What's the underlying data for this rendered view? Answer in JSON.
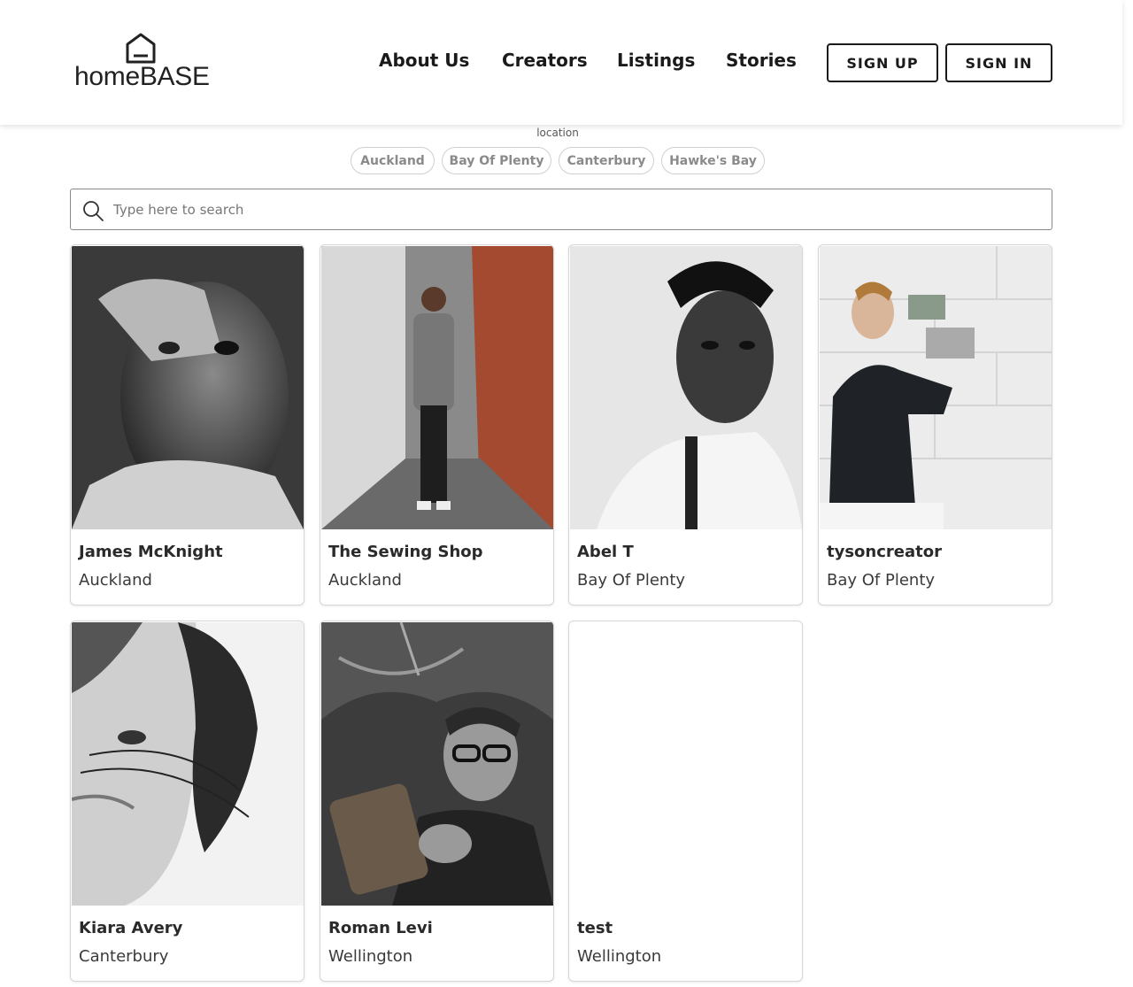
{
  "header": {
    "logo_text": "homeBASE",
    "nav": [
      "About Us",
      "Creators",
      "Listings",
      "Stories"
    ],
    "sign_up": "SIGN UP",
    "sign_in": "SIGN IN"
  },
  "filters": {
    "label": "location",
    "chips": [
      "Auckland",
      "Bay Of Plenty",
      "Canterbury",
      "Hawke's Bay"
    ]
  },
  "search": {
    "placeholder": "Type here to search",
    "value": ""
  },
  "cards": [
    {
      "name": "James McKnight",
      "location": "Auckland"
    },
    {
      "name": "The Sewing Shop",
      "location": "Auckland"
    },
    {
      "name": "Abel T",
      "location": "Bay Of Plenty"
    },
    {
      "name": "tysoncreator",
      "location": "Bay Of Plenty"
    },
    {
      "name": "Kiara Avery",
      "location": "Canterbury"
    },
    {
      "name": "Roman Levi",
      "location": "Wellington"
    },
    {
      "name": "test",
      "location": "Wellington"
    }
  ],
  "icons": {
    "logo": "house-icon",
    "search": "search-icon"
  }
}
